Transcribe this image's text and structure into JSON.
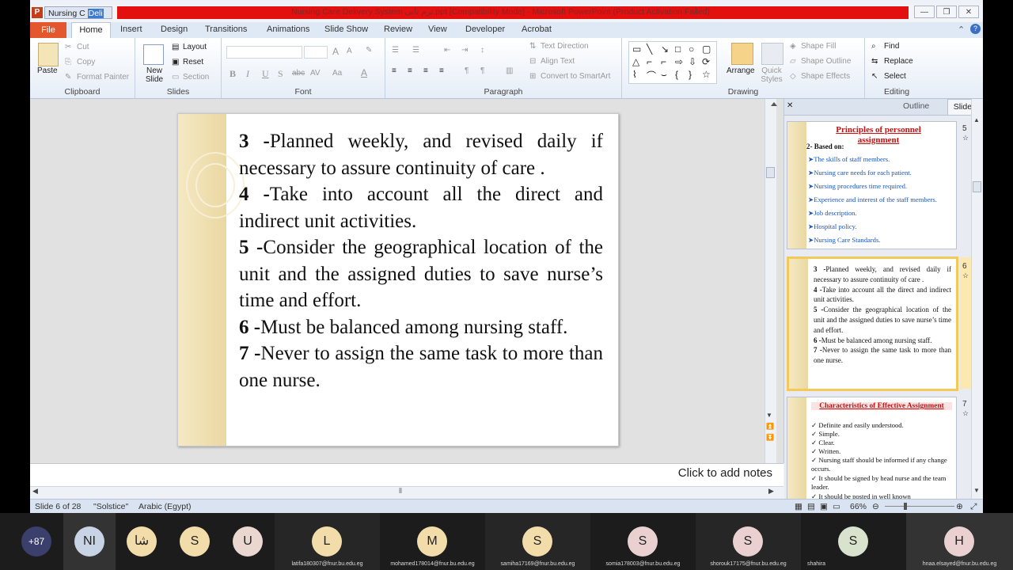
{
  "window": {
    "tab_pill": "Nursing C",
    "tab_pill2": "Deli",
    "title": "Nursing Care Delivery System ترم ثانى.ppt [Compatibility Mode] - Microsoft PowerPoint (Product Activation Failed)",
    "minimize": "—",
    "restore": "❐",
    "close": "✕"
  },
  "menu": {
    "file": "File",
    "tabs": [
      "Home",
      "Insert",
      "Design",
      "Transitions",
      "Animations",
      "Slide Show",
      "Review",
      "View",
      "Developer",
      "Acrobat"
    ]
  },
  "ribbon": {
    "clipboard": {
      "paste": "Paste",
      "cut": "Cut",
      "copy": "Copy",
      "format_painter": "Format Painter",
      "label": "Clipboard"
    },
    "slides": {
      "new_slide": "New Slide",
      "layout": "Layout",
      "reset": "Reset",
      "section": "Section",
      "label": "Slides"
    },
    "font": {
      "bold": "B",
      "italic": "I",
      "underline": "U",
      "shadow": "S",
      "strike": "abc",
      "spacing": "AV",
      "case": "Aa",
      "color": "A",
      "grow": "A",
      "shrink": "A",
      "label": "Font"
    },
    "paragraph": {
      "text_direction": "Text Direction",
      "align_text": "Align Text",
      "smartart": "Convert to SmartArt",
      "label": "Paragraph"
    },
    "drawing": {
      "arrange": "Arrange",
      "quick_styles": "Quick Styles",
      "shape_fill": "Shape Fill",
      "shape_outline": "Shape Outline",
      "shape_effects": "Shape Effects",
      "label": "Drawing"
    },
    "editing": {
      "find": "Find",
      "replace": "Replace",
      "select": "Select",
      "label": "Editing"
    }
  },
  "slide": {
    "items": [
      {
        "num": "3 -",
        "text": "Planned weekly, and revised daily if necessary to assure continuity of care ."
      },
      {
        "num": "4 -",
        "text": "Take into account all the direct and indirect unit activities."
      },
      {
        "num": "5 -",
        "text": "Consider the geographical location of the unit and the assigned duties to save nurse’s time and effort."
      },
      {
        "num": "6 -",
        "text": "Must be balanced among nursing staff."
      },
      {
        "num": "7 -",
        "text": "Never to assign the same task to more than one nurse."
      }
    ]
  },
  "notes": {
    "placeholder": "Click to add notes"
  },
  "panel": {
    "close": "✕",
    "tab_outline": "Outline",
    "tab_slides": "Slides",
    "thumb5": {
      "num": "5",
      "title": "Principles of personnel assignment",
      "based": "2- Based on:",
      "items": [
        "The skills of staff members.",
        "Nursing care needs for each patient.",
        "Nursing procedures time required.",
        "Experience and interest of the staff members.",
        "Job description.",
        "Hospital policy.",
        "Nursing Care Standards."
      ]
    },
    "thumb6": {
      "num": "6",
      "items": [
        {
          "num": "3 -",
          "text": "Planned weekly, and revised daily if necessary to assure continuity of care ."
        },
        {
          "num": "4 -",
          "text": "Take into account all the direct and indirect unit activities."
        },
        {
          "num": "5 -",
          "text": "Consider the geographical location of the unit and the assigned duties to save nurse’s time and effort."
        },
        {
          "num": "6 -",
          "text": "Must be balanced among nursing staff."
        },
        {
          "num": "7 -",
          "text": "Never to assign the same task to more than one nurse."
        }
      ]
    },
    "thumb7": {
      "num": "7",
      "title": "Characteristics of Effective Assignment",
      "items": [
        "Definite and easily understood.",
        "Simple.",
        "Clear.",
        "Written.",
        "Nursing staff should be informed if any change occurs.",
        "It should be signed by head nurse and the team leader.",
        "It should be posted in well known"
      ]
    }
  },
  "status": {
    "slide": "Slide 6 of 28",
    "theme": "\"Solstice\"",
    "language": "Arabic (Egypt)",
    "zoom": "66%"
  },
  "participants": [
    {
      "initials": "+87",
      "name": "",
      "color": "#3a3f6b",
      "text_color": "#ffffff"
    },
    {
      "initials": "NI",
      "name": "",
      "color": "#c9d3e6",
      "text_color": "#222222"
    },
    {
      "initials": "شا",
      "name": "",
      "color": "#f2dcaa",
      "text_color": "#222222"
    },
    {
      "initials": "S",
      "name": "",
      "color": "#f2dcaa",
      "text_color": "#222222"
    },
    {
      "initials": "U",
      "name": "",
      "color": "#ead8d0",
      "text_color": "#222222"
    },
    {
      "initials": "L",
      "name": "latifa180307@fnur.bu.edu.eg",
      "color": "#f2dcaa",
      "text_color": "#222222"
    },
    {
      "initials": "M",
      "name": "mohamed178014@fnur.bu.edu.eg",
      "color": "#f2dcaa",
      "text_color": "#222222"
    },
    {
      "initials": "S",
      "name": "samiha17169@fnur.bu.edu.eg",
      "color": "#f2dcaa",
      "text_color": "#222222"
    },
    {
      "initials": "S",
      "name": "somia178003@fnur.bu.edu.eg",
      "color": "#ead0d0",
      "text_color": "#222222"
    },
    {
      "initials": "S",
      "name": "shorouk17175@fnur.bu.edu.eg",
      "color": "#ead0d0",
      "text_color": "#222222"
    },
    {
      "initials": "S",
      "name": "shahira",
      "color": "#d8e2cc",
      "text_color": "#222222"
    },
    {
      "initials": "H",
      "name": "hnaa.elsayed@fnur.bu.edu.eg",
      "color": "#ead0d0",
      "text_color": "#222222"
    }
  ]
}
